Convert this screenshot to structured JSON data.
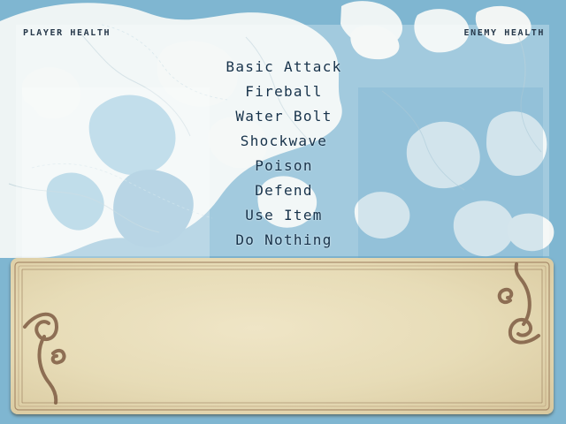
{
  "hud": {
    "player_label": "PLAYER HEALTH",
    "enemy_label": "ENEMY HEALTH"
  },
  "menu": {
    "items": [
      "Basic Attack",
      "Fireball",
      "Water Bolt",
      "Shockwave",
      "Poison",
      "Defend",
      "Use Item",
      "Do Nothing"
    ]
  },
  "dialog": {
    "text": ""
  },
  "colors": {
    "sea": "#7fb6d1",
    "land": "#eef3f3",
    "parchment": "#e8dcb6",
    "frame": "#8b6b4b",
    "text": "#16324a"
  },
  "icons": {
    "left_ornament": "left-filigree-icon",
    "right_ornament": "right-filigree-icon"
  }
}
